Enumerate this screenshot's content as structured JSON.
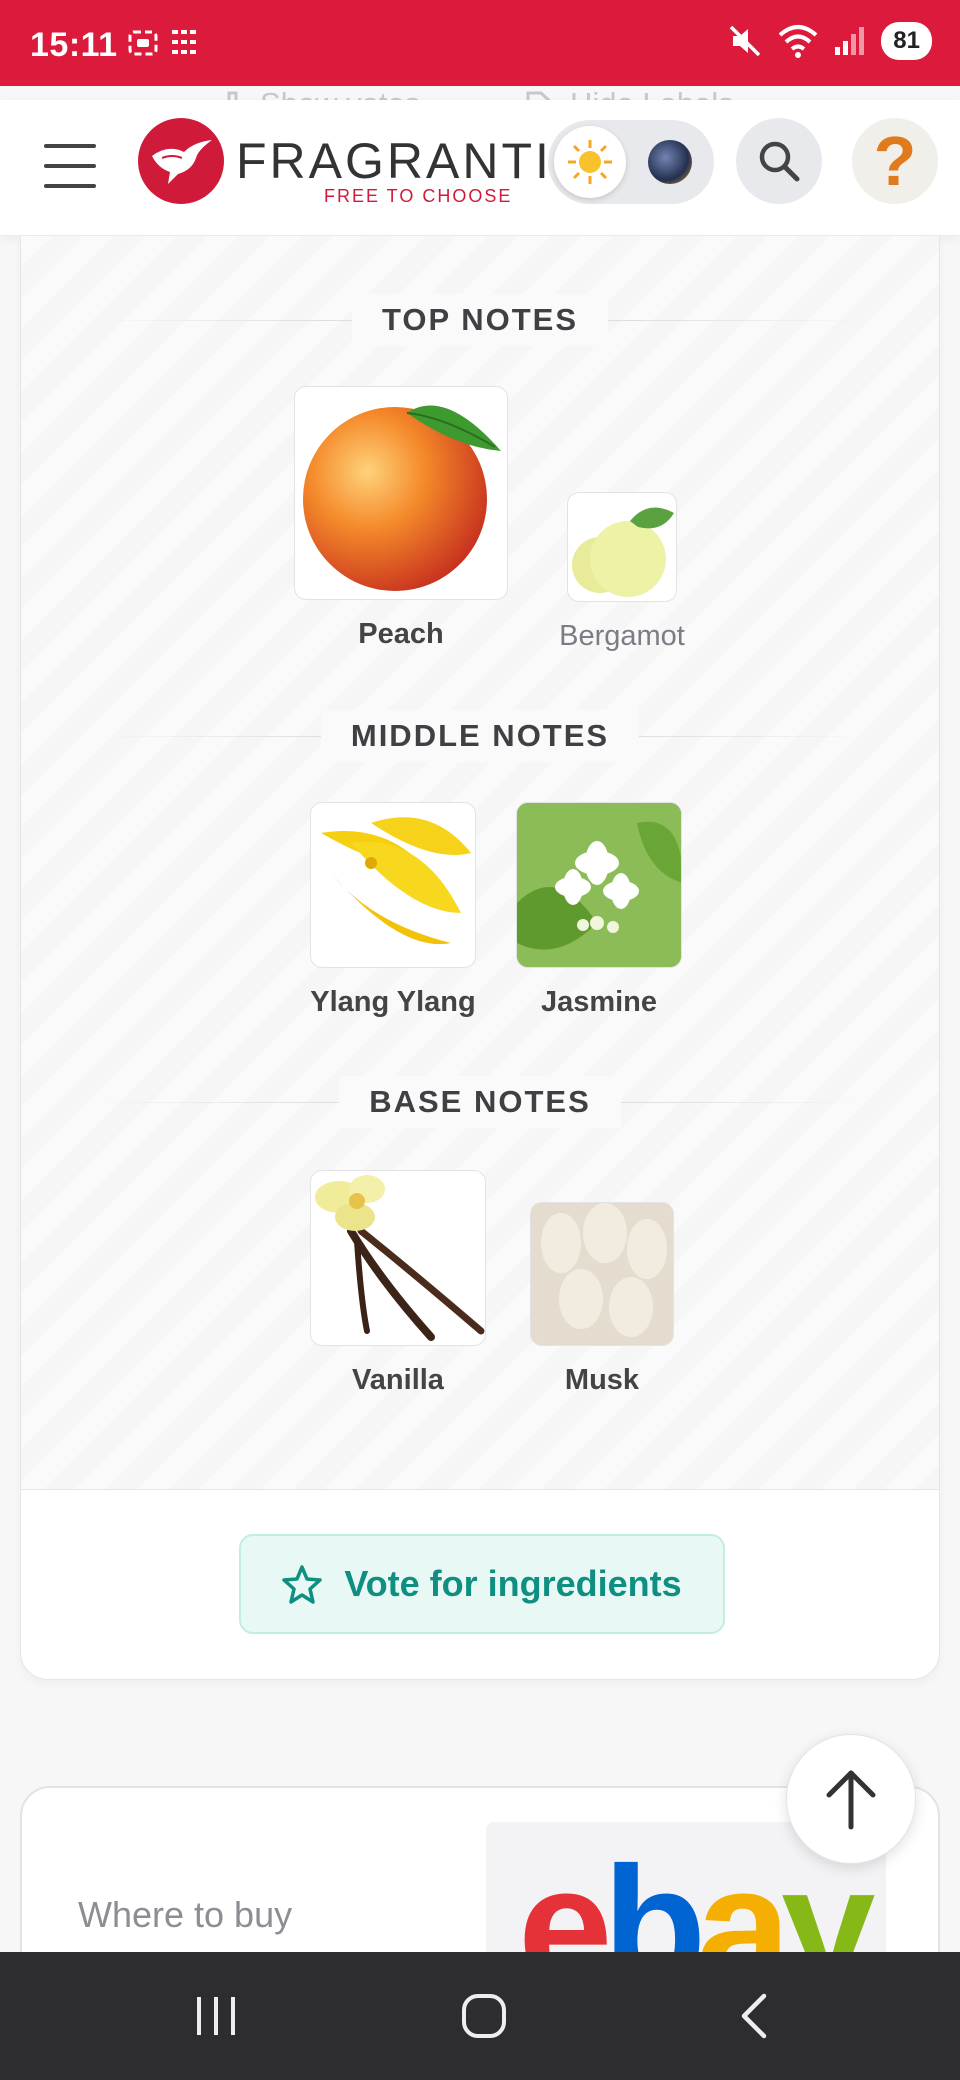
{
  "status_bar": {
    "time": "15:11",
    "battery": "81"
  },
  "toolbar_behind": {
    "show_votes": "Show votes",
    "hide_labels": "Hide Labels"
  },
  "header": {
    "logo_text": "FRAGRANTIC",
    "logo_tagline": "FREE TO CHOOSE",
    "help_glyph": "?"
  },
  "pyramid": {
    "top_notes_title": "TOP NOTES",
    "middle_notes_title": "MIDDLE NOTES",
    "base_notes_title": "BASE NOTES",
    "top_notes": [
      {
        "label": "Peach"
      },
      {
        "label": "Bergamot"
      }
    ],
    "middle_notes": [
      {
        "label": "Ylang Ylang"
      },
      {
        "label": "Jasmine"
      }
    ],
    "base_notes": [
      {
        "label": "Vanilla"
      },
      {
        "label": "Musk"
      }
    ]
  },
  "vote": {
    "label": "Vote for ingredients"
  },
  "where_to_buy": {
    "label": "Where to buy",
    "store": "ebay"
  },
  "colors": {
    "brand_red": "#dc1a3c",
    "teal_accent": "#0f8e82"
  }
}
